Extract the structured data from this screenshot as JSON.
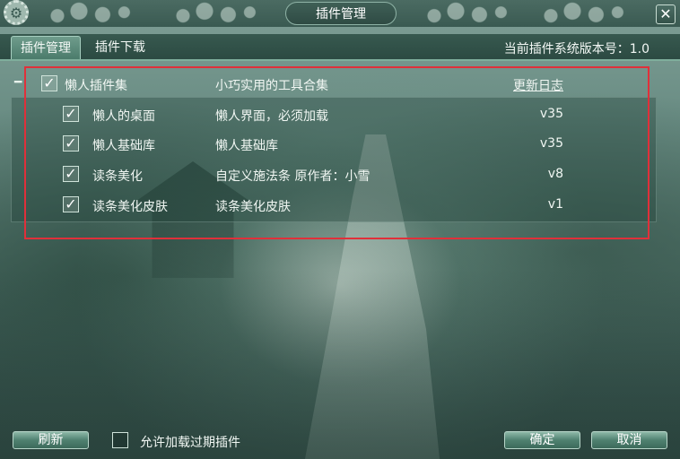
{
  "window": {
    "title": "插件管理",
    "close_symbol": "✕"
  },
  "tabs": [
    {
      "label": "插件管理",
      "active": true
    },
    {
      "label": "插件下载",
      "active": false
    }
  ],
  "version_info": "当前插件系统版本号：1.0",
  "collapse_symbol": "━",
  "plugin_group": {
    "name": "懒人插件集",
    "description": "小巧实用的工具合集",
    "link": "更新日志",
    "checked": true,
    "plugins": [
      {
        "name": "懒人的桌面",
        "description": "懒人界面，必须加载",
        "version": "v35",
        "checked": true
      },
      {
        "name": "懒人基础库",
        "description": "懒人基础库",
        "version": "v35",
        "checked": true
      },
      {
        "name": "读条美化",
        "description": "自定义施法条 原作者：小雪",
        "version": "v8",
        "checked": true
      },
      {
        "name": "读条美化皮肤",
        "description": "读条美化皮肤",
        "version": "v1",
        "checked": true
      }
    ]
  },
  "footer": {
    "refresh_label": "刷新",
    "allow_expired_label": "允许加载过期插件",
    "allow_expired_checked": false,
    "confirm_label": "确定",
    "cancel_label": "取消"
  },
  "check_symbol": "✓",
  "colors": {
    "highlight": "#e0303a",
    "accent": "#4f8170"
  }
}
